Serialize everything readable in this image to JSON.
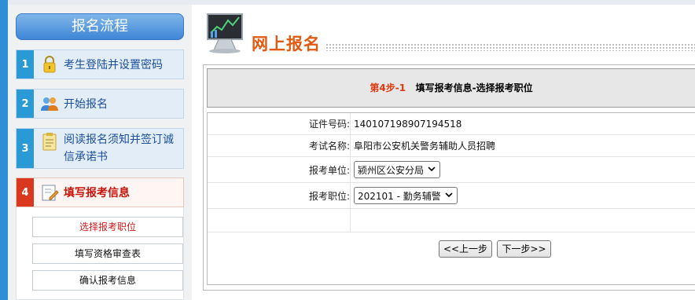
{
  "sidebar": {
    "header": "报名流程",
    "steps": [
      {
        "num": "1",
        "label": "考生登陆并设置密码",
        "icon": "lock-icon"
      },
      {
        "num": "2",
        "label": "开始报名",
        "icon": "users-icon"
      },
      {
        "num": "3",
        "label": "阅读报名须知并签订诚信承诺书",
        "icon": "clipboard-icon"
      },
      {
        "num": "4",
        "label": "填写报考信息",
        "icon": "edit-icon"
      }
    ],
    "substeps": [
      "选择报考职位",
      "填写资格审查表",
      "确认报考信息"
    ]
  },
  "main": {
    "title": "网上报名",
    "step_tag": "第4步-1",
    "step_title": "填写报考信息-选择报考职位",
    "fields": {
      "id_label": "证件号码:",
      "id_value": "140107198907194518",
      "exam_label": "考试名称:",
      "exam_value": "阜阳市公安机关警务辅助人员招聘",
      "unit_label": "报考单位:",
      "unit_value": "颍州区公安分局",
      "position_label": "报考职位:",
      "position_value": "202101 - 勤务辅警"
    },
    "buttons": {
      "prev": "<<上一步",
      "next": "下一步>>"
    }
  },
  "colors": {
    "accent_blue": "#2f8fd6",
    "active_red": "#d9381e",
    "title_orange": "#e05a12"
  }
}
